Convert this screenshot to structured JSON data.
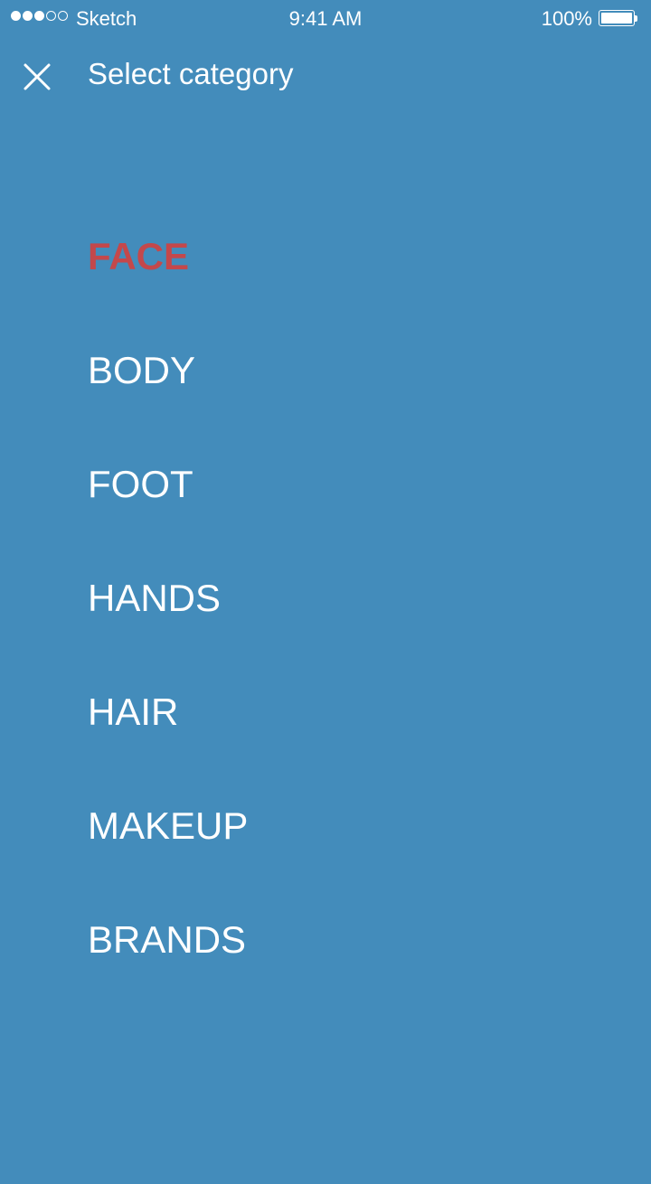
{
  "status_bar": {
    "carrier": "Sketch",
    "time": "9:41 AM",
    "battery": "100%",
    "signal_bars_filled": 3,
    "signal_bars_total": 5
  },
  "header": {
    "close_icon": "close-icon",
    "title": "Select category"
  },
  "categories": [
    {
      "label": "FACE",
      "selected": true
    },
    {
      "label": "BODY",
      "selected": false
    },
    {
      "label": "FOOT",
      "selected": false
    },
    {
      "label": "HANDS",
      "selected": false
    },
    {
      "label": "HAIR",
      "selected": false
    },
    {
      "label": "MAKEUP",
      "selected": false
    },
    {
      "label": "BRANDS",
      "selected": false
    }
  ],
  "colors": {
    "background": "#438CBB",
    "text": "#FFFFFF",
    "selected": "#C4484B"
  }
}
